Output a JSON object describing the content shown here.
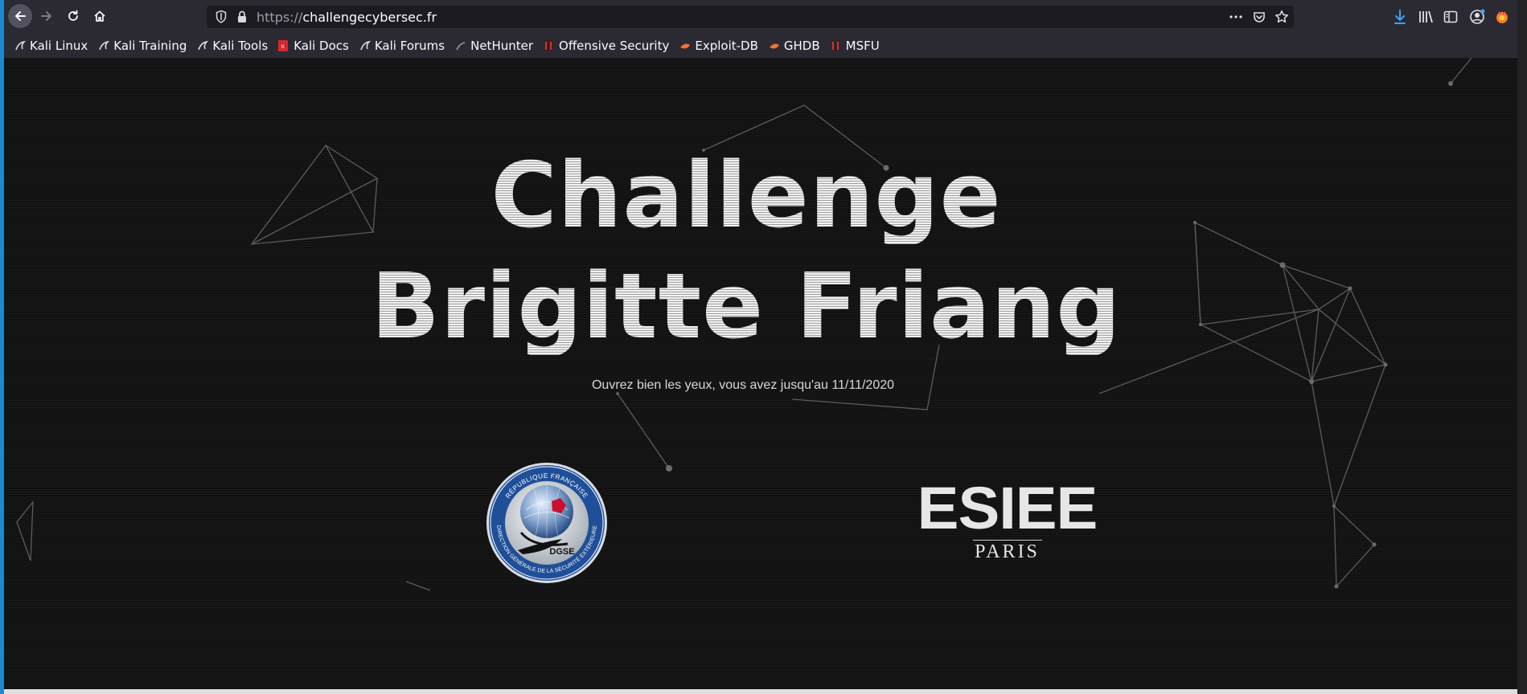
{
  "browser": {
    "url_protocol": "https://",
    "url_host": "challengecybersec.fr",
    "icons": {
      "back": "back-arrow-icon",
      "forward": "forward-arrow-icon",
      "reload": "reload-icon",
      "home": "home-icon",
      "page_actions": "more-icon",
      "pocket": "pocket-icon",
      "bookmark_star": "star-icon",
      "downloads": "download-icon",
      "library": "library-icon",
      "sidebar": "sidebar-icon",
      "account": "account-icon",
      "extension": "firefox-extension-icon"
    }
  },
  "bookmarks": [
    {
      "label": "Kali Linux",
      "icon": "kali-dragon-icon"
    },
    {
      "label": "Kali Training",
      "icon": "kali-dragon-icon"
    },
    {
      "label": "Kali Tools",
      "icon": "kali-dragon-icon"
    },
    {
      "label": "Kali Docs",
      "icon": "kali-docs-icon"
    },
    {
      "label": "Kali Forums",
      "icon": "kali-dragon-icon"
    },
    {
      "label": "NetHunter",
      "icon": "nethunter-icon"
    },
    {
      "label": "Offensive Security",
      "icon": "offsec-icon"
    },
    {
      "label": "Exploit-DB",
      "icon": "exploit-db-icon"
    },
    {
      "label": "GHDB",
      "icon": "ghdb-icon"
    },
    {
      "label": "MSFU",
      "icon": "msfu-icon"
    }
  ],
  "page": {
    "title_line1": "Challenge",
    "title_line2": "Brigitte Friang",
    "subtitle": "Ouvrez bien les yeux, vous avez jusqu'au 11/11/2020",
    "dgse_logo": {
      "ring_top": "RÉPUBLIQUE FRANÇAISE",
      "ring_bottom": "DIRECTION GÉNÉRALE DE LA SÉCURITÉ EXTÉRIEURE",
      "center": "DGSE"
    },
    "esiee_logo": {
      "word": "ESIEE",
      "city": "PARIS"
    }
  }
}
